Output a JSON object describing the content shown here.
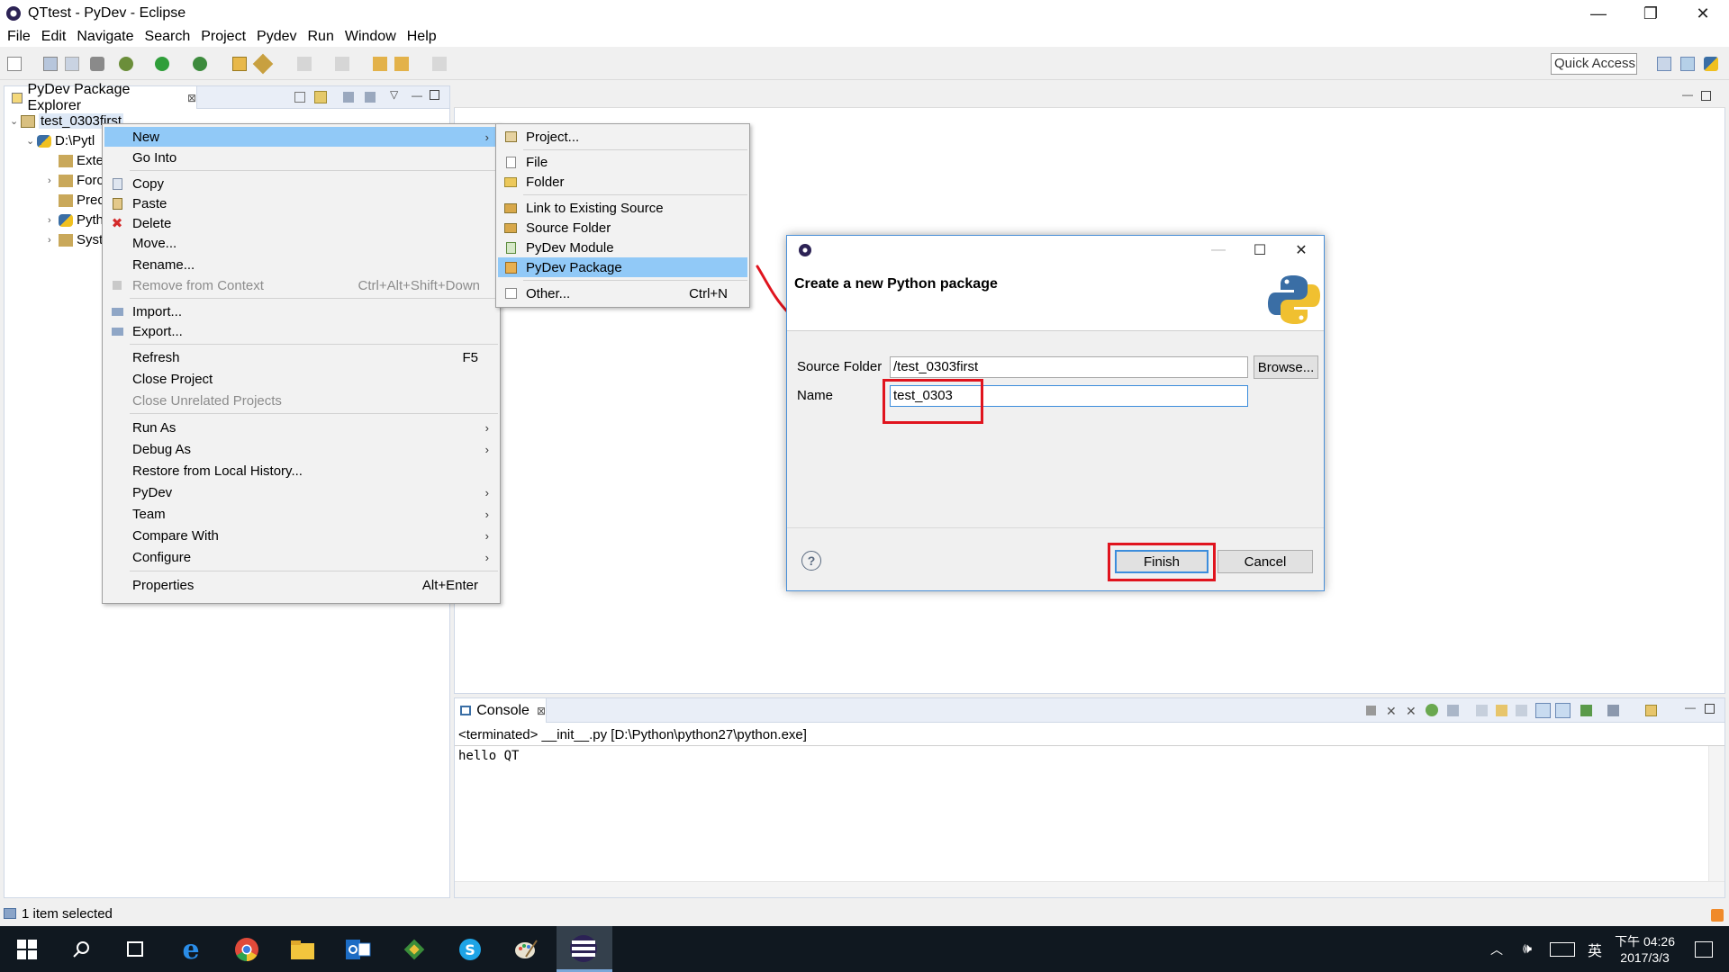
{
  "window": {
    "title": "QTtest - PyDev - Eclipse",
    "minimize": "—",
    "maximize": "❐",
    "close": "✕"
  },
  "menubar": [
    "File",
    "Edit",
    "Navigate",
    "Search",
    "Project",
    "Pydev",
    "Run",
    "Window",
    "Help"
  ],
  "toolbar": {
    "quick_access": "Quick Access"
  },
  "explorer": {
    "tab_label": "PyDev Package Explorer",
    "tab_close": "⊠",
    "tree": [
      {
        "label": "test_0303first",
        "arrow": "⌄"
      },
      {
        "label": "D:\\Pytl",
        "arrow": "⌄"
      },
      {
        "label": "Exte",
        "arrow": ""
      },
      {
        "label": "Forc",
        "arrow": "›"
      },
      {
        "label": "Prec",
        "arrow": ""
      },
      {
        "label": "Pyth",
        "arrow": "›"
      },
      {
        "label": "Syst",
        "arrow": "›"
      }
    ]
  },
  "context_menu": {
    "items": [
      {
        "label": "New",
        "submenu": "›",
        "highlight": true
      },
      {
        "label": "Go Into"
      },
      {
        "label": "Copy"
      },
      {
        "label": "Paste"
      },
      {
        "label": "Delete"
      },
      {
        "label": "Move..."
      },
      {
        "label": "Rename..."
      },
      {
        "label": "Remove from Context",
        "accel": "Ctrl+Alt+Shift+Down",
        "disabled": true
      },
      {
        "label": "Import..."
      },
      {
        "label": "Export..."
      },
      {
        "label": "Refresh",
        "accel": "F5"
      },
      {
        "label": "Close Project"
      },
      {
        "label": "Close Unrelated Projects",
        "disabled": true
      },
      {
        "label": "Run As",
        "submenu": "›"
      },
      {
        "label": "Debug As",
        "submenu": "›"
      },
      {
        "label": "Restore from Local History..."
      },
      {
        "label": "PyDev",
        "submenu": "›"
      },
      {
        "label": "Team",
        "submenu": "›"
      },
      {
        "label": "Compare With",
        "submenu": "›"
      },
      {
        "label": "Configure",
        "submenu": "›"
      },
      {
        "label": "Properties",
        "accel": "Alt+Enter"
      }
    ]
  },
  "new_submenu": {
    "items": [
      {
        "label": "Project..."
      },
      {
        "label": "File"
      },
      {
        "label": "Folder"
      },
      {
        "label": "Link to Existing Source"
      },
      {
        "label": "Source Folder"
      },
      {
        "label": "PyDev Module"
      },
      {
        "label": "PyDev Package",
        "highlight": true
      },
      {
        "label": "Other...",
        "accel": "Ctrl+N"
      }
    ]
  },
  "dialog": {
    "header_title": "Create a new Python package",
    "source_folder_label": "Source Folder",
    "source_folder_value": "/test_0303first",
    "browse": "Browse...",
    "name_label": "Name",
    "name_value": "test_0303",
    "help": "?",
    "finish": "Finish",
    "cancel": "Cancel",
    "minimize": "—",
    "maximize": "☐",
    "close": "✕"
  },
  "console": {
    "tab_label": "Console",
    "tab_close": "⊠",
    "status": "<terminated> __init__.py [D:\\Python\\python27\\python.exe]",
    "output": "hello QT"
  },
  "statusbar": {
    "text": "1 item selected"
  },
  "taskbar": {
    "clock_time": "下午 04:26",
    "clock_date": "2017/3/3",
    "ime": "英"
  },
  "colors": {
    "highlight": "#91c9f7",
    "annotation_red": "#e0141e",
    "accent_blue": "#3c8ddc"
  }
}
